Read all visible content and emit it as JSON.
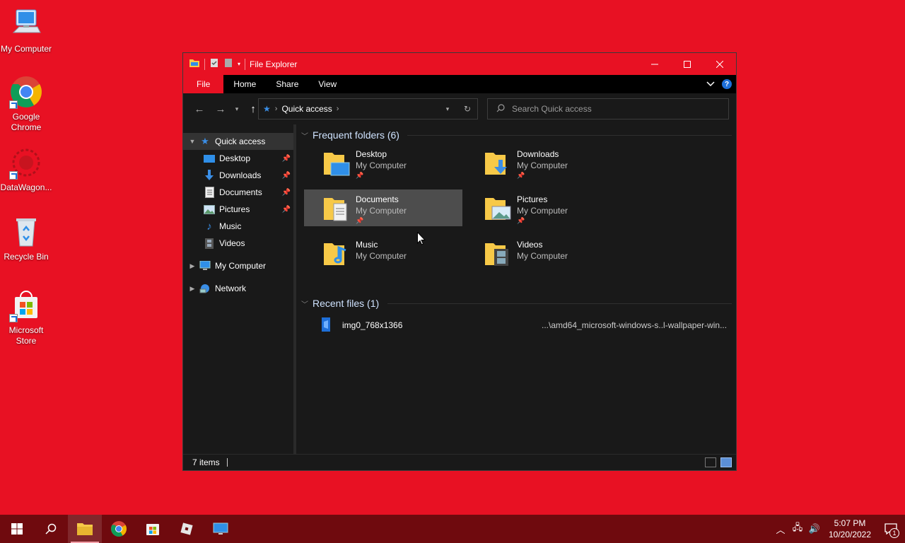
{
  "desktop": {
    "icons": [
      {
        "label": "My Computer",
        "icon": "computer-icon"
      },
      {
        "label": "Google Chrome",
        "icon": "chrome-icon"
      },
      {
        "label": "DataWagon...",
        "icon": "datawagon-icon"
      },
      {
        "label": "Recycle Bin",
        "icon": "recycle-bin-icon"
      },
      {
        "label": "Microsoft Store",
        "icon": "store-icon"
      }
    ]
  },
  "window": {
    "title": "File Explorer",
    "ribbon_tabs": [
      "File",
      "Home",
      "Share",
      "View"
    ],
    "address": {
      "location": "Quick access"
    },
    "search": {
      "placeholder": "Search Quick access"
    },
    "nav": {
      "quick_access": "Quick access",
      "pinned": [
        "Desktop",
        "Downloads",
        "Documents",
        "Pictures"
      ],
      "unpinned": [
        "Music",
        "Videos"
      ],
      "my_computer": "My Computer",
      "network": "Network"
    },
    "frequent_header": "Frequent folders (6)",
    "folders": [
      {
        "name": "Desktop",
        "location": "My Computer",
        "pinned": true
      },
      {
        "name": "Downloads",
        "location": "My Computer",
        "pinned": true
      },
      {
        "name": "Documents",
        "location": "My Computer",
        "pinned": true
      },
      {
        "name": "Pictures",
        "location": "My Computer",
        "pinned": true
      },
      {
        "name": "Music",
        "location": "My Computer",
        "pinned": false
      },
      {
        "name": "Videos",
        "location": "My Computer",
        "pinned": false
      }
    ],
    "recent_header": "Recent files (1)",
    "recent_files": [
      {
        "name": "img0_768x1366",
        "path": "...\\amd64_microsoft-windows-s..l-wallpaper-win..."
      }
    ],
    "status": "7 items"
  },
  "taskbar": {
    "time": "5:07 PM",
    "date": "10/20/2022",
    "notification_count": "1"
  },
  "colors": {
    "accent": "#e81123",
    "taskbar": "#6f0a0e",
    "window_bg": "#191919",
    "selection": "#4d4d4d"
  }
}
